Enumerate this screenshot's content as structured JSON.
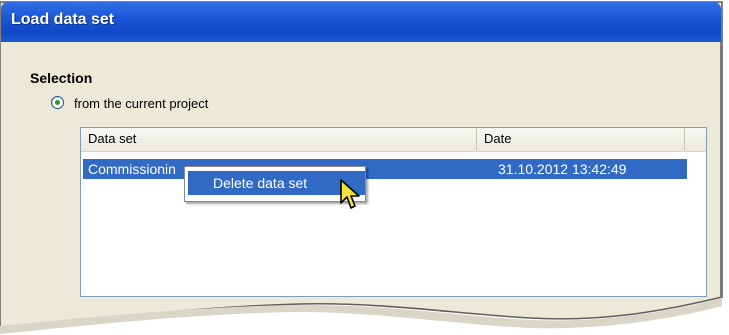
{
  "dialog": {
    "title": "Load data set"
  },
  "selection": {
    "heading": "Selection",
    "radio_label": "from the current project",
    "radio_checked": true
  },
  "list": {
    "columns": [
      "Data set",
      "Date"
    ],
    "rows": [
      {
        "name": "Commissionin",
        "date": "31.10.2012 13:42:49",
        "selected": true
      }
    ]
  },
  "context_menu": {
    "items": [
      "Delete data set"
    ]
  },
  "icons": {
    "cursor": "arrow-pointer-icon"
  },
  "colors": {
    "titlebar": "#0f48c8",
    "selection": "#316ac5",
    "dialog_bg": "#ece9d8"
  }
}
